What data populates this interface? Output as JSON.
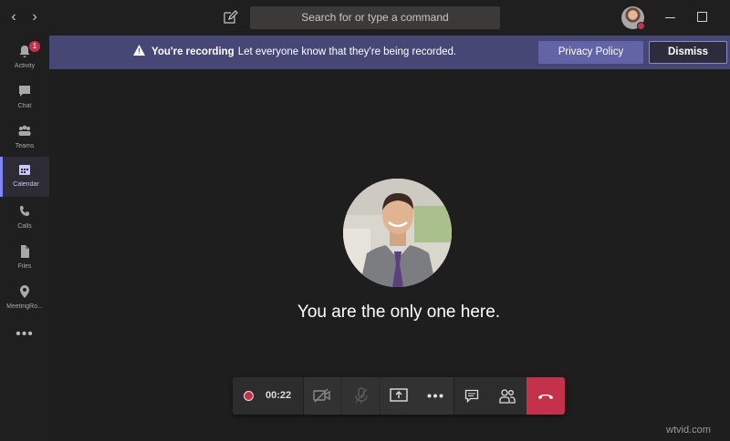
{
  "titlebar": {
    "search_placeholder": "Search for or type a command",
    "back_icon": "chevron-left-icon",
    "forward_icon": "chevron-right-icon"
  },
  "rail": {
    "items": [
      {
        "label": "Activity",
        "icon": "bell-icon",
        "badge": "1"
      },
      {
        "label": "Chat",
        "icon": "chat-icon"
      },
      {
        "label": "Teams",
        "icon": "teams-icon"
      },
      {
        "label": "Calendar",
        "icon": "calendar-icon",
        "active": true
      },
      {
        "label": "Calls",
        "icon": "phone-icon"
      },
      {
        "label": "Files",
        "icon": "file-icon"
      },
      {
        "label": "MeetingRo...",
        "icon": "location-pin-icon"
      }
    ],
    "more": "•••"
  },
  "banner": {
    "title": "You're recording",
    "message": "Let everyone know that they're being recorded.",
    "privacy_button": "Privacy Policy",
    "dismiss_button": "Dismiss"
  },
  "stage": {
    "message": "You are the only one here."
  },
  "callbar": {
    "timer": "00:22"
  },
  "watermark": "wtvid.com",
  "colors": {
    "accent": "#6264a7",
    "banner_bg": "#464775",
    "hangup": "#c4314b",
    "background": "#1f1f1f"
  }
}
